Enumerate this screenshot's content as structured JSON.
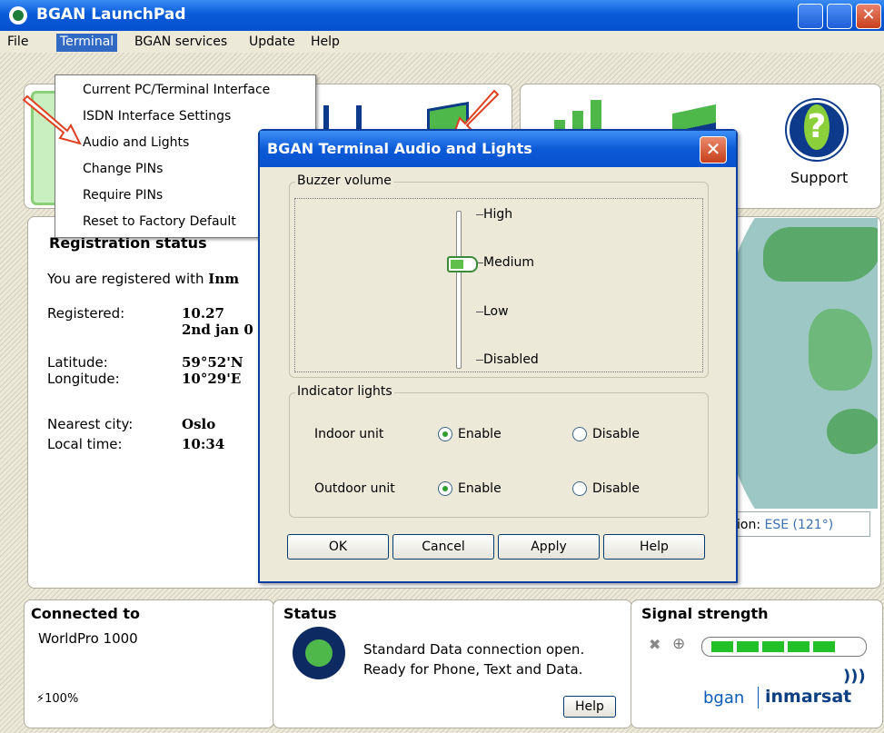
{
  "window": {
    "title": "BGAN LaunchPad"
  },
  "menubar": [
    "File",
    "Terminal",
    "BGAN services",
    "Update",
    "Help"
  ],
  "terminal_menu": {
    "items": [
      "Current PC/Terminal Interface",
      "ISDN Interface Settings",
      "Audio and Lights",
      "Change PINs",
      "Require PINs",
      "Reset to Factory Default"
    ]
  },
  "toolbar": {
    "support_label": "Support"
  },
  "registration": {
    "title": "Registration status",
    "message": "You are registered with",
    "message_bold": "Inm",
    "registered_label": "Registered:",
    "registered_time": "10.27",
    "registered_date": "2nd jan 0",
    "latitude_label": "Latitude:",
    "latitude_value": "59°52'N",
    "longitude_label": "Longitude:",
    "longitude_value": "10°29'E",
    "city_label": "Nearest city:",
    "city_value": "Oslo",
    "localtime_label": "Local time:",
    "localtime_value": "10:34"
  },
  "map": {
    "azimuth_prefix": "ion:",
    "azimuth_value": "ESE (121°)"
  },
  "dialog": {
    "title": "BGAN Terminal Audio and Lights",
    "buzzer": {
      "legend": "Buzzer volume",
      "levels": [
        "High",
        "Medium",
        "Low",
        "Disabled"
      ],
      "selected": "Medium"
    },
    "lights": {
      "legend": "Indicator lights",
      "rows": [
        {
          "label": "Indoor unit",
          "enable": "Enable",
          "disable": "Disable",
          "value": "Enable"
        },
        {
          "label": "Outdoor unit",
          "enable": "Enable",
          "disable": "Disable",
          "value": "Enable"
        }
      ]
    },
    "buttons": [
      "OK",
      "Cancel",
      "Apply",
      "Help"
    ]
  },
  "bottom": {
    "connected": {
      "heading": "Connected to",
      "device": "WorldPro 1000",
      "battery": "100%"
    },
    "status": {
      "heading": "Status",
      "line1": "Standard Data connection open.",
      "line2": "Ready for Phone, Text and Data.",
      "help": "Help"
    },
    "signal": {
      "heading": "Signal strength",
      "level_segments": 5,
      "brand_left": "bgan",
      "brand_right": "inmarsat"
    }
  },
  "colors": {
    "titlebar": "#0a5bd8",
    "accent_green": "#4fb84a",
    "signal_green": "#23c02a",
    "highlight": "#316ac5"
  }
}
